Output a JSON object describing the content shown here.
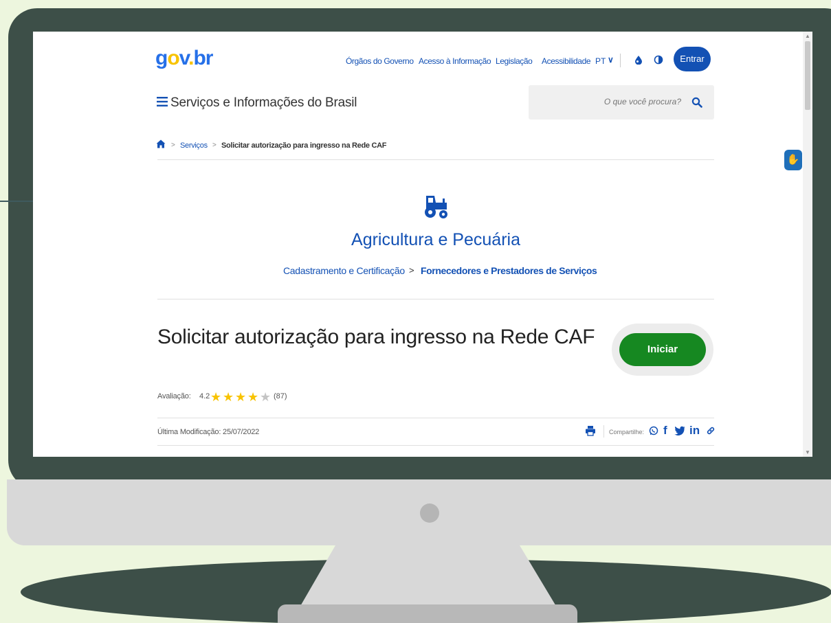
{
  "header": {
    "logo": {
      "g": "g",
      "o": "o",
      "v": "v",
      "dot": ".",
      "br": "br"
    },
    "links": [
      "Órgãos do Governo",
      "Acesso à Informação",
      "Legislação",
      "Acessibilidade"
    ],
    "language": "PT",
    "login_label": "Entrar",
    "site_title": "Serviços e Informações do Brasil",
    "search_placeholder": "O que você procura?"
  },
  "breadcrumb": {
    "items": [
      "Serviços",
      "Solicitar autorização para ingresso na Rede CAF"
    ]
  },
  "category": {
    "icon": "tractor-icon",
    "title": "Agricultura e Pecuária",
    "subcategory": "Cadastramento e Certificação",
    "separator": ">",
    "topic": "Fornecedores e Prestadores de Serviços"
  },
  "service": {
    "title": "Solicitar autorização para ingresso na Rede CAF",
    "start_label": "Iniciar",
    "rating_label": "Avaliação:",
    "rating_value": "4.2",
    "rating_stars": 4.2,
    "rating_count": "(87)",
    "last_modified": "Última Modificação: 25/07/2022",
    "share_label": "Compartilhe:",
    "share_icons": [
      "whatsapp-icon",
      "facebook-icon",
      "twitter-icon",
      "linkedin-icon",
      "link-icon"
    ]
  },
  "colors": {
    "primary": "#1351b4",
    "start_button": "#168821",
    "star": "#f8c300",
    "bezel": "#3d4f48",
    "background": "#edf6de"
  }
}
